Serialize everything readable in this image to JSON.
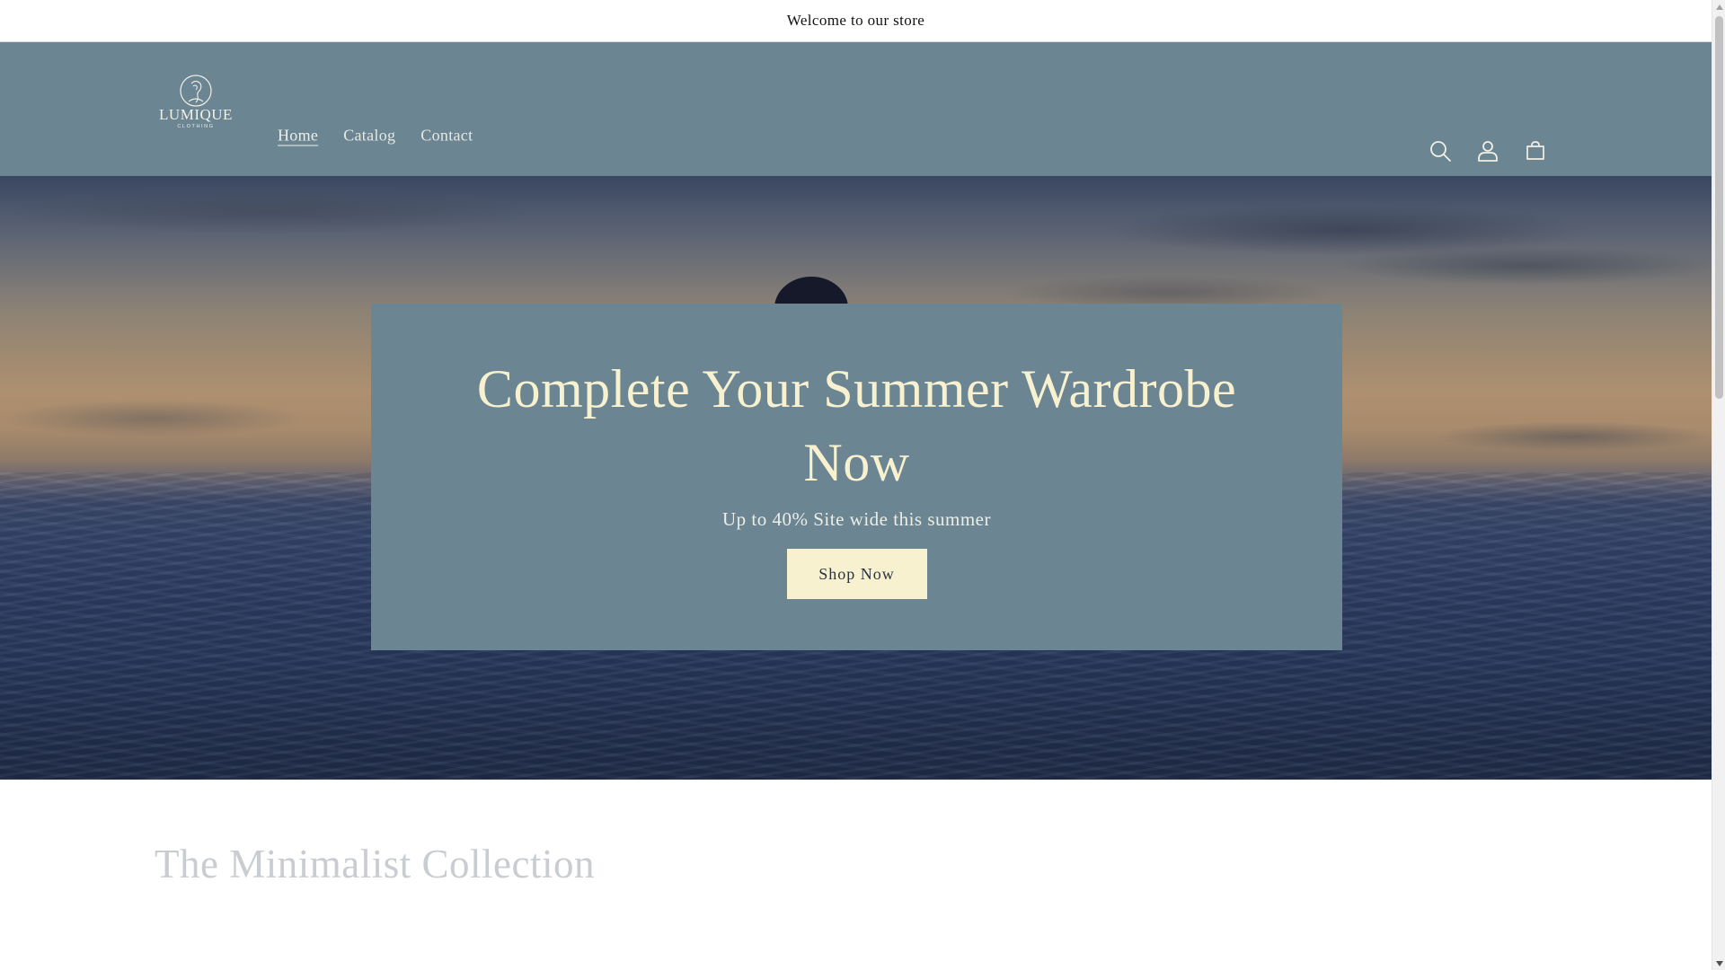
{
  "announcement": {
    "text": "Welcome to our store"
  },
  "logo": {
    "name": "LUMIQUE",
    "sub": "CLOTHING"
  },
  "nav": {
    "items": [
      {
        "label": "Home",
        "active": true
      },
      {
        "label": "Catalog",
        "active": false
      },
      {
        "label": "Contact",
        "active": false
      }
    ]
  },
  "header_icons": [
    "search-icon",
    "account-icon",
    "cart-icon"
  ],
  "hero": {
    "title": "Complete Your Summer Wardrobe Now",
    "subtitle": "Up to 40% Site wide this summer",
    "button_label": "Shop Now"
  },
  "collection": {
    "title": "The Minimalist Collection"
  },
  "colors": {
    "header_bg": "#6b8593",
    "hero_box_bg": "#6b8593",
    "accent_cream": "#f7f1cf",
    "collection_title": "#c9ccd0"
  }
}
